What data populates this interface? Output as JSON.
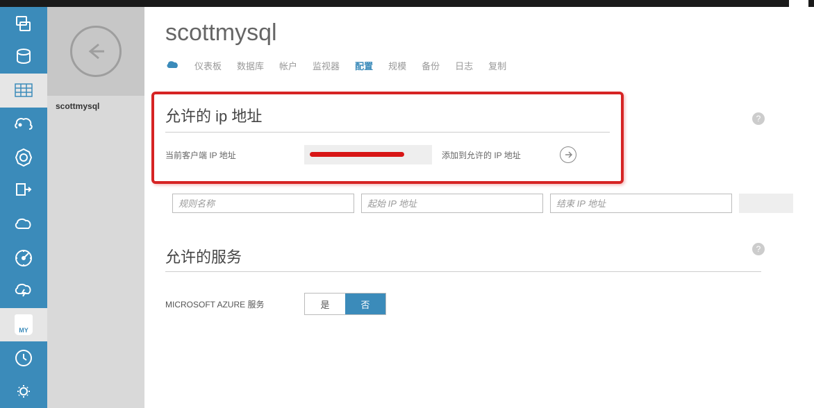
{
  "page": {
    "title": "scottmysql",
    "breadcrumb": "scottmysql"
  },
  "tabs": {
    "dashboard": "仪表板",
    "database": "数据库",
    "account": "帐户",
    "monitor": "监视器",
    "configure": "配置",
    "scale": "规模",
    "backup": "备份",
    "logs": "日志",
    "replicate": "复制"
  },
  "allowed_ip": {
    "title": "允许的 ip 地址",
    "current_label": "当前客户端 IP 地址",
    "add_label": "添加到允许的 IP 地址"
  },
  "rule_inputs": {
    "name_placeholder": "规则名称",
    "start_placeholder": "起始 IP 地址",
    "end_placeholder": "结束 IP 地址"
  },
  "allowed_services": {
    "title": "允许的服务",
    "azure_label": "MICROSOFT AZURE 服务",
    "yes": "是",
    "no": "否"
  },
  "help_glyph": "?",
  "rail": {
    "items": [
      "databases-icon",
      "db-cylinder-icon",
      "grid-icon",
      "hadoop-icon",
      "cog-circle-icon",
      "deploy-icon",
      "cloud-gear-icon",
      "gauge-icon",
      "cloud-bolt-icon",
      "mysql-icon",
      "clock-icon",
      "settings-icon"
    ]
  }
}
